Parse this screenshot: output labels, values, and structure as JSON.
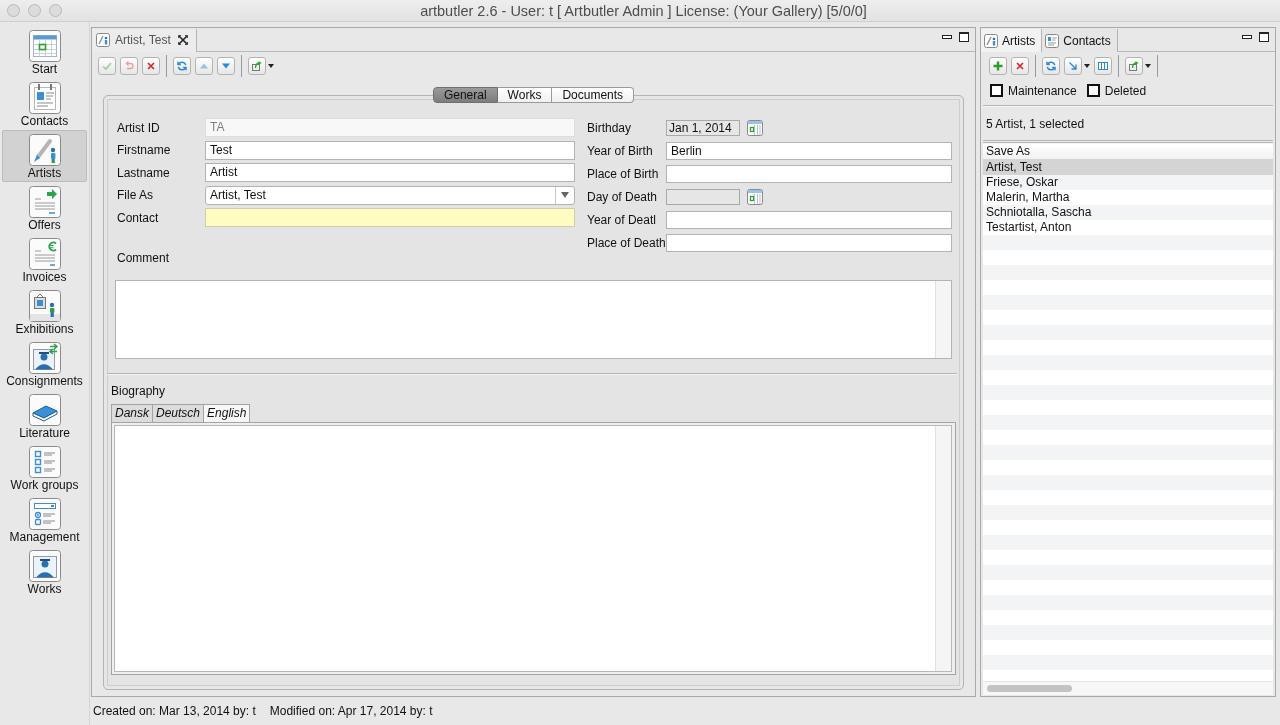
{
  "window": {
    "title": "artbutler 2.6 - User: t [ Artbutler Admin ] License: (Your Gallery) [5/0/0]"
  },
  "sidebar": {
    "items": [
      {
        "label": "Start",
        "selected": false
      },
      {
        "label": "Contacts",
        "selected": false
      },
      {
        "label": "Artists",
        "selected": true
      },
      {
        "label": "Offers",
        "selected": false
      },
      {
        "label": "Invoices",
        "selected": false
      },
      {
        "label": "Exhibitions",
        "selected": false
      },
      {
        "label": "Consignments",
        "selected": false
      },
      {
        "label": "Literature",
        "selected": false
      },
      {
        "label": "Work groups",
        "selected": false
      },
      {
        "label": "Management",
        "selected": false
      },
      {
        "label": "Works",
        "selected": false
      }
    ]
  },
  "editor": {
    "tab": {
      "label": "Artist, Test"
    },
    "toolbar": [
      {
        "disabled": true
      },
      {
        "disabled": true
      },
      {
        "disabled": false
      },
      {
        "disabled": false
      },
      {
        "disabled": true
      },
      {
        "disabled": false
      },
      {
        "disabled": false
      }
    ],
    "tabs": [
      {
        "label": "General",
        "selected": true
      },
      {
        "label": "Works",
        "selected": false
      },
      {
        "label": "Documents",
        "selected": false
      }
    ],
    "fields_left": [
      {
        "label": "Artist ID",
        "kind": "text",
        "value": "TA",
        "disabled": true
      },
      {
        "label": "Firstname",
        "kind": "text",
        "value": "Test",
        "disabled": false
      },
      {
        "label": "Lastname",
        "kind": "text",
        "value": "Artist",
        "disabled": false
      },
      {
        "label": "File As",
        "kind": "combo",
        "value": "Artist, Test",
        "disabled": false
      },
      {
        "label": "Contact",
        "kind": "highlighted",
        "disabled": false
      }
    ],
    "fields_right": [
      {
        "label": "Birthday",
        "kind": "date",
        "value": "Jan 1, 2014"
      },
      {
        "label": "Year of Birth",
        "kind": "text",
        "value": "Berlin"
      },
      {
        "label": "Place of Birth",
        "kind": "text"
      },
      {
        "label": "Day of Death",
        "kind": "date"
      },
      {
        "label": "Year of Deatl",
        "kind": "text"
      },
      {
        "label": "Place of Death",
        "kind": "text"
      }
    ],
    "comment": {
      "label": "Comment"
    },
    "biography": {
      "label": "Biography",
      "tabs": [
        {
          "label": "Dansk",
          "selected": false
        },
        {
          "label": "Deutsch",
          "selected": false
        },
        {
          "label": "English",
          "selected": true
        }
      ]
    }
  },
  "artists_panel": {
    "tabs": [
      {
        "label": "Artists",
        "selected": true
      },
      {
        "label": "Contacts",
        "selected": false
      }
    ],
    "checkboxes": [
      {
        "label": "Maintenance",
        "checked": false
      },
      {
        "label": "Deleted",
        "checked": false
      }
    ],
    "summary": "5 Artist, 1 selected",
    "table": {
      "columns": [
        "Save As"
      ],
      "rows": [
        {
          "cells": [
            "Artist, Test"
          ],
          "selected": true
        },
        {
          "cells": [
            "Friese, Oskar"
          ],
          "selected": false
        },
        {
          "cells": [
            "Malerin, Martha"
          ],
          "selected": false
        },
        {
          "cells": [
            "Schniotalla, Sascha"
          ],
          "selected": false
        },
        {
          "cells": [
            "Testartist, Anton"
          ],
          "selected": false
        }
      ]
    }
  },
  "status_bar": {
    "items": [
      "Created on: Mar 13, 2014 by: t",
      "Modified on: Apr 17, 2014 by: t"
    ]
  }
}
